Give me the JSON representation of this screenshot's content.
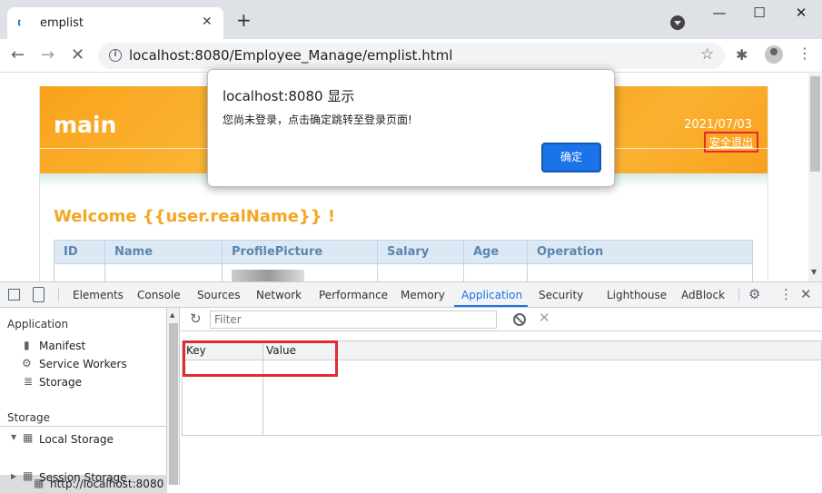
{
  "browser": {
    "tab_title": "emplist",
    "tab_close": "✕",
    "new_tab": "+",
    "window_min": "—",
    "window_max": "☐",
    "window_close": "✕",
    "nav_back": "←",
    "nav_forward": "→",
    "nav_stop": "✕",
    "url": "localhost:8080/Employee_Manage/emplist.html",
    "star": "☆",
    "extensions": "✱",
    "menu": "⋮"
  },
  "page": {
    "site_title": "main",
    "date": "2021/07/03",
    "logout_link": "安全退出",
    "welcome": "Welcome {{user.realName}} !",
    "table_headers": [
      "ID",
      "Name",
      "ProfilePicture",
      "Salary",
      "Age",
      "Operation"
    ]
  },
  "alert": {
    "title": "localhost:8080 显示",
    "message": "您尚未登录，点击确定跳转至登录页面!",
    "ok_label": "确定"
  },
  "devtools": {
    "tabs": [
      "Elements",
      "Console",
      "Sources",
      "Network",
      "Performance",
      "Memory",
      "Application",
      "Security",
      "Lighthouse",
      "AdBlock"
    ],
    "active_tab": "Application",
    "gear": "⚙",
    "menu": "⋮",
    "close": "✕",
    "sidebar": {
      "application_header": "Application",
      "manifest": "Manifest",
      "service_workers": "Service Workers",
      "storage_item": "Storage",
      "storage_header": "Storage",
      "local_storage": "Local Storage",
      "local_storage_origin": "http://localhost:8080",
      "session_storage": "Session Storage"
    },
    "filter_placeholder": "Filter",
    "refresh": "↻",
    "delete": "✕",
    "kv_columns": {
      "key": "Key",
      "value": "Value"
    }
  },
  "colors": {
    "header_orange": "#f9a21b",
    "welcome_orange": "#f5a623",
    "accent_blue": "#1a73e8",
    "highlight_red": "#e12b34"
  }
}
